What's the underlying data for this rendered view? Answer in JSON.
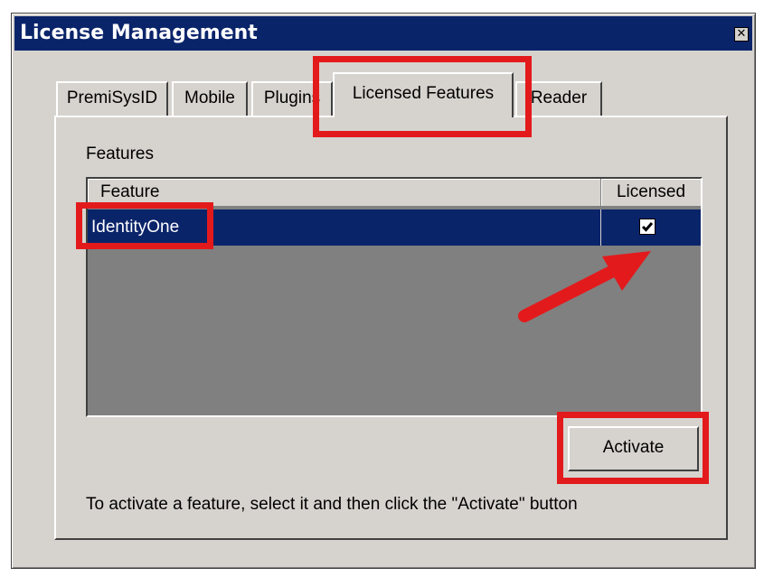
{
  "window": {
    "title": "License Management",
    "close_symbol": "✕"
  },
  "tabs": [
    {
      "label": "PremiSysID",
      "active": false
    },
    {
      "label": "Mobile",
      "active": false
    },
    {
      "label": "Plugins",
      "active": false
    },
    {
      "label": "Licensed Features",
      "active": true
    },
    {
      "label": "Reader",
      "active": false
    }
  ],
  "features_group": {
    "label": "Features",
    "columns": [
      "Feature",
      "Licensed"
    ],
    "rows": [
      {
        "feature": "IdentityOne",
        "licensed": true,
        "selected": true
      }
    ]
  },
  "activate_button": {
    "label": "Activate"
  },
  "help_text": "To activate a feature, select it and then click the \"Activate\" button",
  "colors": {
    "titlebar": "#0a246a",
    "dialog_bg": "#d6d3ce",
    "selection": "#0a246a",
    "annotation": "#e31a1c"
  }
}
